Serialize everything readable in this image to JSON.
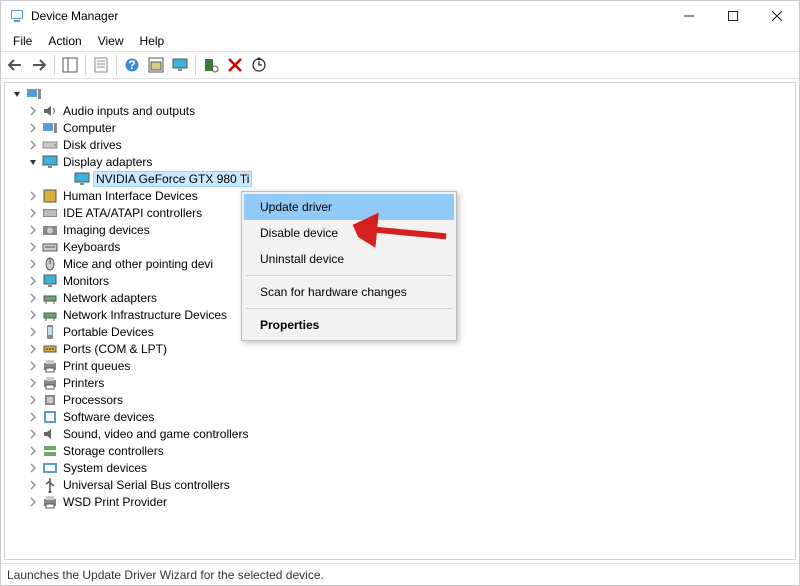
{
  "window": {
    "title": "Device Manager",
    "btn_min": "Minimize",
    "btn_max": "Maximize",
    "btn_close": "Close"
  },
  "menu": {
    "items": [
      "File",
      "Action",
      "View",
      "Help"
    ]
  },
  "toolbar": {
    "back": "back-icon",
    "forward": "forward-icon",
    "properties_pane": "properties-pane-icon",
    "properties": "properties-icon",
    "help": "help-icon",
    "show_hidden": "show-hidden-icon",
    "monitor": "monitor-icon",
    "scan": "scan-icon",
    "delete": "delete-icon",
    "update": "update-icon"
  },
  "tree": {
    "root": " ",
    "items": [
      {
        "label": "Audio inputs and outputs",
        "expanded": false,
        "icon": "speaker"
      },
      {
        "label": "Computer",
        "expanded": false,
        "icon": "computer"
      },
      {
        "label": "Disk drives",
        "expanded": false,
        "icon": "disk"
      },
      {
        "label": "Display adapters",
        "expanded": true,
        "icon": "display",
        "children": [
          {
            "label": "NVIDIA GeForce GTX 980 Ti",
            "selected": true,
            "icon": "display"
          }
        ]
      },
      {
        "label": "Human Interface Devices",
        "expanded": false,
        "icon": "hid"
      },
      {
        "label": "IDE ATA/ATAPI controllers",
        "expanded": false,
        "icon": "ide"
      },
      {
        "label": "Imaging devices",
        "expanded": false,
        "icon": "camera"
      },
      {
        "label": "Keyboards",
        "expanded": false,
        "icon": "keyboard"
      },
      {
        "label": "Mice and other pointing devi",
        "expanded": false,
        "icon": "mouse"
      },
      {
        "label": "Monitors",
        "expanded": false,
        "icon": "monitor"
      },
      {
        "label": "Network adapters",
        "expanded": false,
        "icon": "network"
      },
      {
        "label": "Network Infrastructure Devices",
        "expanded": false,
        "icon": "network"
      },
      {
        "label": "Portable Devices",
        "expanded": false,
        "icon": "portable"
      },
      {
        "label": "Ports (COM & LPT)",
        "expanded": false,
        "icon": "port"
      },
      {
        "label": "Print queues",
        "expanded": false,
        "icon": "printer"
      },
      {
        "label": "Printers",
        "expanded": false,
        "icon": "printer"
      },
      {
        "label": "Processors",
        "expanded": false,
        "icon": "cpu"
      },
      {
        "label": "Software devices",
        "expanded": false,
        "icon": "software"
      },
      {
        "label": "Sound, video and game controllers",
        "expanded": false,
        "icon": "sound"
      },
      {
        "label": "Storage controllers",
        "expanded": false,
        "icon": "storage"
      },
      {
        "label": "System devices",
        "expanded": false,
        "icon": "system"
      },
      {
        "label": "Universal Serial Bus controllers",
        "expanded": false,
        "icon": "usb"
      },
      {
        "label": "WSD Print Provider",
        "expanded": false,
        "icon": "printer"
      }
    ]
  },
  "context": {
    "items": [
      {
        "label": "Update driver",
        "hover": true
      },
      {
        "label": "Disable device"
      },
      {
        "label": "Uninstall device"
      },
      {
        "sep": true
      },
      {
        "label": "Scan for hardware changes"
      },
      {
        "sep": true
      },
      {
        "label": "Properties",
        "bold": true
      }
    ]
  },
  "status": "Launches the Update Driver Wizard for the selected device."
}
